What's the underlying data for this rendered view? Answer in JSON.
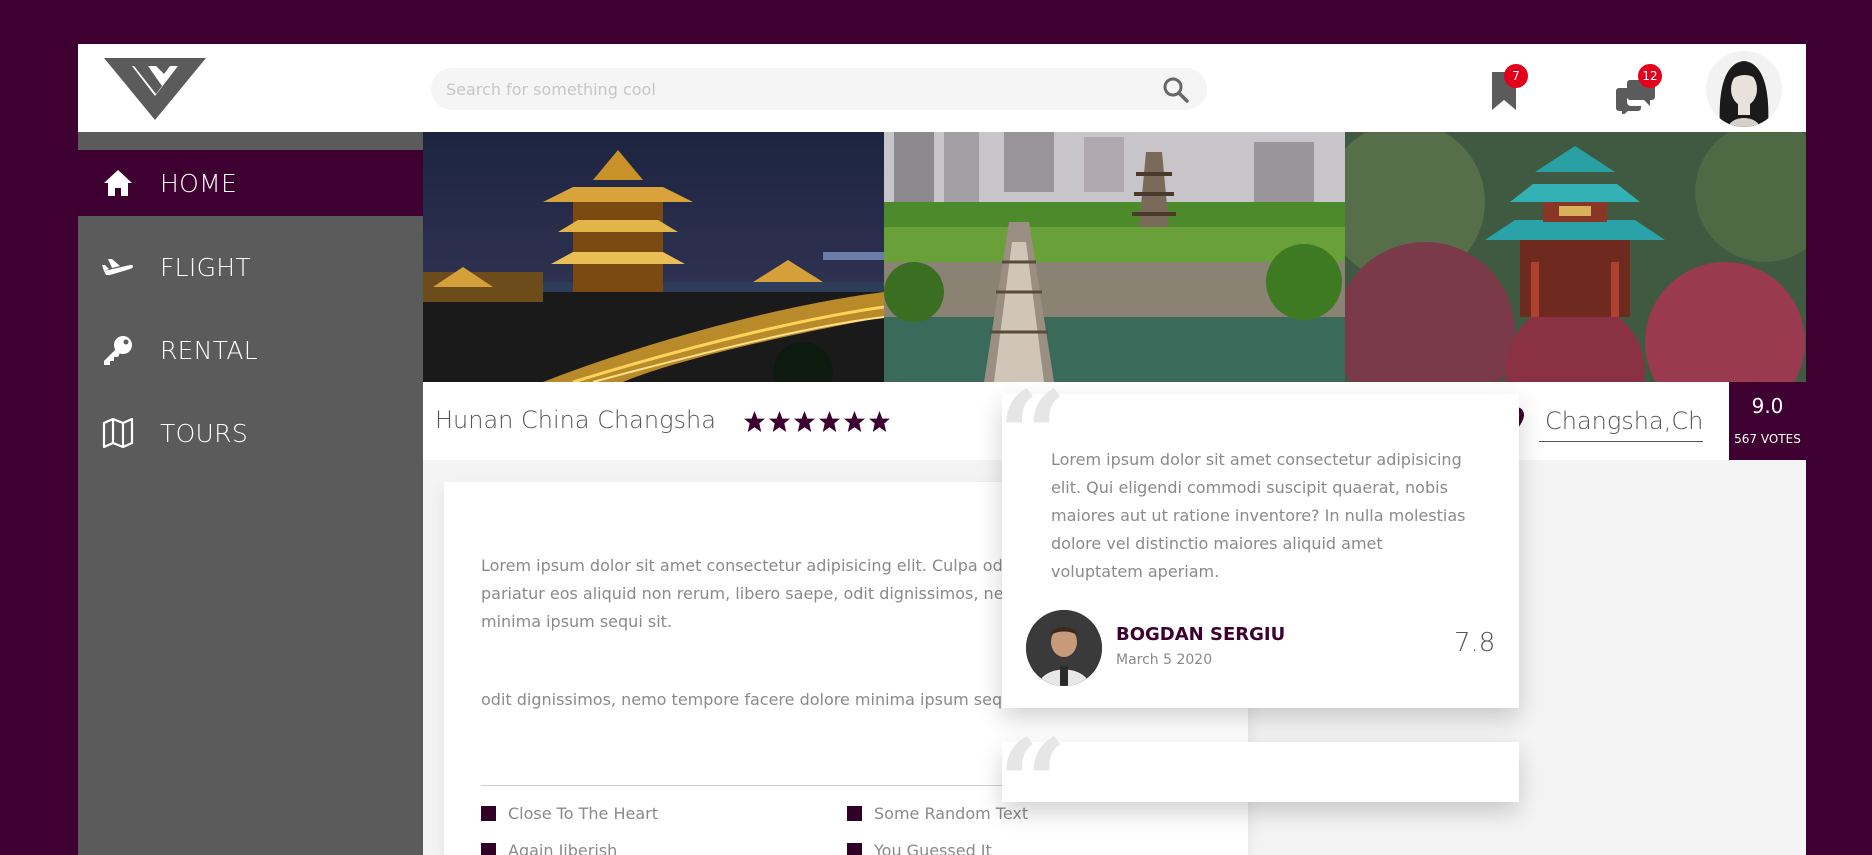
{
  "header": {
    "search_placeholder": "Search for something cool",
    "bookmarks_count": "7",
    "messages_count": "12"
  },
  "sidebar": {
    "items": [
      {
        "label": "HOME",
        "icon": "home-icon",
        "active": true
      },
      {
        "label": "FLIGHT",
        "icon": "airplane-icon",
        "active": false
      },
      {
        "label": "RENTAL",
        "icon": "key-icon",
        "active": false
      },
      {
        "label": "TOURS",
        "icon": "map-icon",
        "active": false
      }
    ]
  },
  "hotel": {
    "name": "Hunan China Changsha",
    "stars": 6,
    "location_value": "Changsha,Ch",
    "score": "9.0",
    "votes": "567 VOTES"
  },
  "content": {
    "paragraph1": "Lorem ipsum dolor sit amet consectetur adipisicing elit. Culpa odio dicta voluptas impedit pariatur eos aliquid non rerum, libero saepe, odit dignissimos, nemo tempore facere dolore minima ipsum sequi sit.",
    "paragraph2": "odit dignissimos, nemo tempore facere dolore minima ipsum sequi sit.",
    "features": [
      "Close To The Heart",
      "Some Random Text",
      "Again Jiberish",
      "You Guessed It"
    ]
  },
  "review": {
    "text": "Lorem ipsum dolor sit amet consectetur adipisicing elit. Qui eligendi commodi suscipit quaerat, nobis maiores aut ut ratione inventore? In nulla molestias dolore vel distinctio maiores aliquid amet voluptatem aperiam.",
    "author": "BOGDAN SERGIU",
    "date": "March 5 2020",
    "score": "7.8"
  },
  "colors": {
    "brand": "#3d0030",
    "sidebar": "#5b5b5b",
    "badge": "#e3001b"
  }
}
